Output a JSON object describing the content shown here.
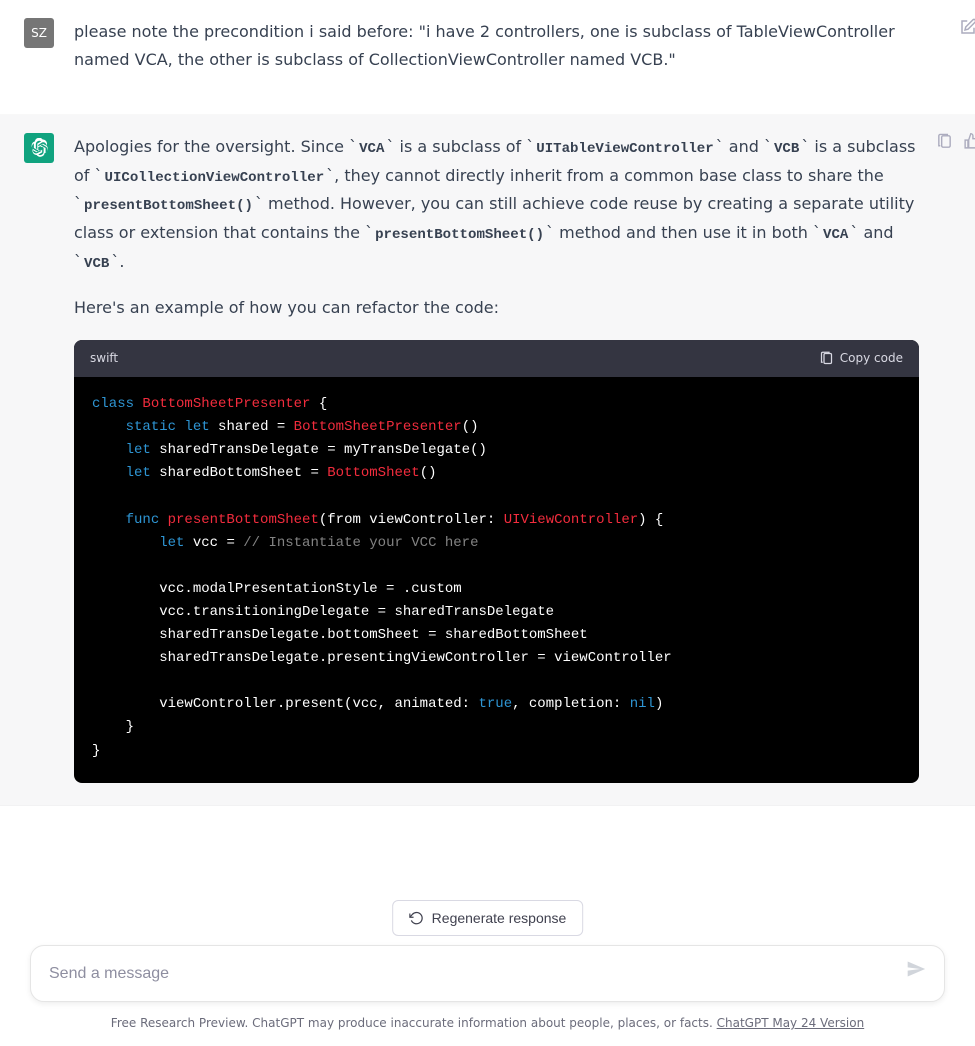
{
  "user": {
    "avatar_text": "SZ",
    "message": "please note the precondition i said before:  \"i have 2 controllers, one is subclass of TableViewController named VCA, the other is subclass of CollectionViewController named VCB.\""
  },
  "assistant": {
    "para1": {
      "t1": "Apologies for the oversight. Since ",
      "c1": "VCA",
      "t2": " is a subclass of ",
      "c2": "UITableViewController",
      "t3": " and ",
      "c3": "VCB",
      "t4": " is a subclass of ",
      "c4": "UICollectionViewController",
      "t5": ", they cannot directly inherit from a common base class to share the ",
      "c5": "presentBottomSheet()",
      "t6": " method. However, you can still achieve code reuse by creating a separate utility class or extension that contains the ",
      "c6": "presentBottomSheet()",
      "t7": " method and then use it in both ",
      "c7": "VCA",
      "t8": " and ",
      "c8": "VCB",
      "t9": "."
    },
    "para2": "Here's an example of how you can refactor the code:",
    "code": {
      "lang": "swift",
      "copy_label": "Copy code",
      "tokens": {
        "class": "class",
        "static": "static",
        "let": "let",
        "func": "func",
        "true": "true",
        "nil": "nil",
        "BottomSheetPresenter": "BottomSheetPresenter",
        "BottomSheet": "BottomSheet",
        "presentBottomSheet": "presentBottomSheet",
        "UIViewController": "UIViewController",
        "comment": "// Instantiate your VCC here",
        "shared_decl": " shared = ",
        "paren_open_close": "()",
        "brace_open": " {",
        "brace_close": "}",
        "sharedTransDel_line": " sharedTransDelegate = myTransDelegate()",
        "sharedBottom_line_pre": " sharedBottomSheet = ",
        "func_sig_pre": "(from viewController: ",
        "func_sig_post": ") {",
        "let_vcc": " vcc = ",
        "body1": "vcc.modalPresentationStyle = .custom",
        "body2": "vcc.transitioningDelegate = sharedTransDelegate",
        "body3": "sharedTransDelegate.bottomSheet = sharedBottomSheet",
        "body4": "sharedTransDelegate.presentingViewController = viewController",
        "present_pre": "viewController.present(vcc, animated: ",
        "present_mid": ", completion: ",
        "present_post": ")"
      }
    }
  },
  "regenerate_label": "Regenerate response",
  "composer": {
    "placeholder": "Send a message"
  },
  "footer": {
    "text": "Free Research Preview. ChatGPT may produce inaccurate information about people, places, or facts. ",
    "link": "ChatGPT May 24 Version"
  }
}
